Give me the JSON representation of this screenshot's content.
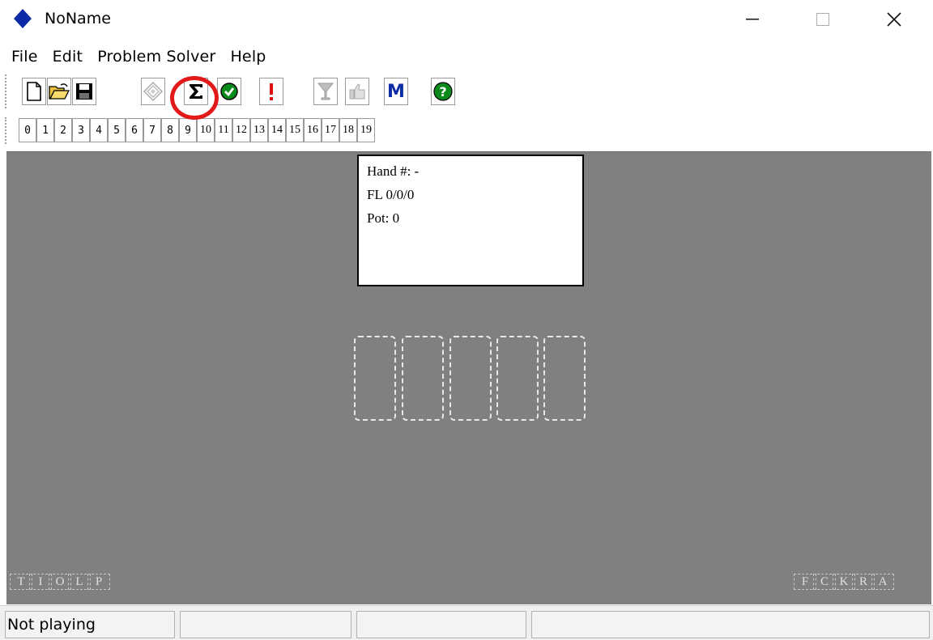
{
  "window": {
    "title": "NoName",
    "icon": "blue-diamond-icon",
    "controls": [
      "minimize-icon",
      "maximize-icon",
      "close-icon"
    ]
  },
  "menu": [
    "File",
    "Edit",
    "Problem Solver",
    "Help"
  ],
  "toolbar": {
    "buttons": [
      {
        "name": "new-icon"
      },
      {
        "name": "open-folder-icon"
      },
      {
        "name": "save-disk-icon"
      },
      {
        "name": "diamond-target-icon",
        "disabled": true
      },
      {
        "name": "sigma-icon",
        "highlighted": true
      },
      {
        "name": "green-check-icon"
      },
      {
        "name": "red-exclamation-icon"
      },
      {
        "name": "trophy-cup-icon",
        "disabled": true
      },
      {
        "name": "thumbs-up-icon",
        "disabled": true
      },
      {
        "name": "m-letter-icon",
        "label": "M"
      },
      {
        "name": "help-question-icon"
      }
    ]
  },
  "seats": [
    "0",
    "1",
    "2",
    "3",
    "4",
    "5",
    "6",
    "7",
    "8",
    "9",
    "10",
    "11",
    "12",
    "13",
    "14",
    "15",
    "16",
    "17",
    "18",
    "19"
  ],
  "info": {
    "hand": "Hand #: -",
    "fl": "FL 0/0/0",
    "pot": "Pot: 0"
  },
  "card_slots": 5,
  "left_letters": [
    "T",
    "I",
    "O",
    "L",
    "P"
  ],
  "right_letters": [
    "F",
    "C",
    "K",
    "R",
    "A"
  ],
  "status": {
    "pane1": "Not playing",
    "pane2": "",
    "pane3": "",
    "pane4": ""
  },
  "colors": {
    "table": "#808080",
    "accent_blue": "#0a2aa6",
    "highlight_red": "#e21919",
    "green": "#0a8a1a"
  }
}
